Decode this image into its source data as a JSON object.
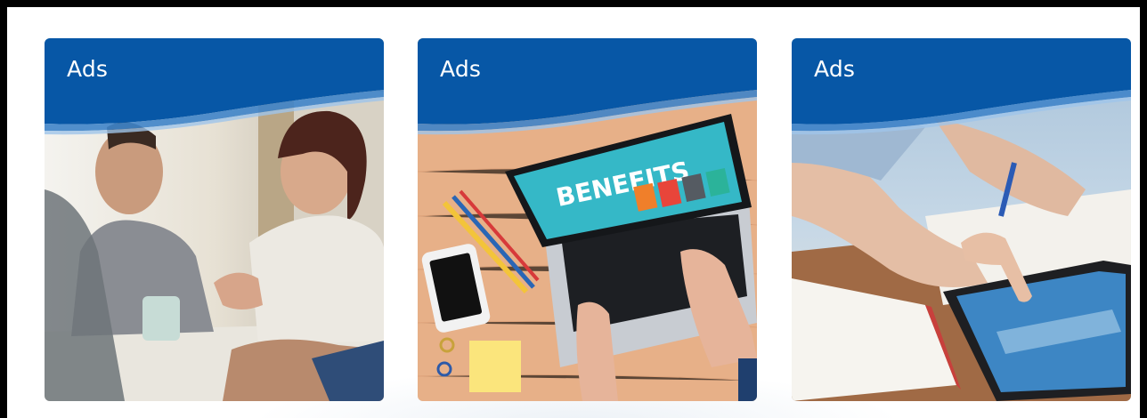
{
  "cards": [
    {
      "title": "Ads",
      "image": "business-meeting-photo",
      "header_color": "#0757a6"
    },
    {
      "title": "Ads",
      "image": "laptop-benefits-photo",
      "header_color": "#0757a6",
      "laptop_screen_text": "BENEFITS"
    },
    {
      "title": "Ads",
      "image": "tablet-news-photo",
      "header_color": "#0757a6"
    }
  ]
}
